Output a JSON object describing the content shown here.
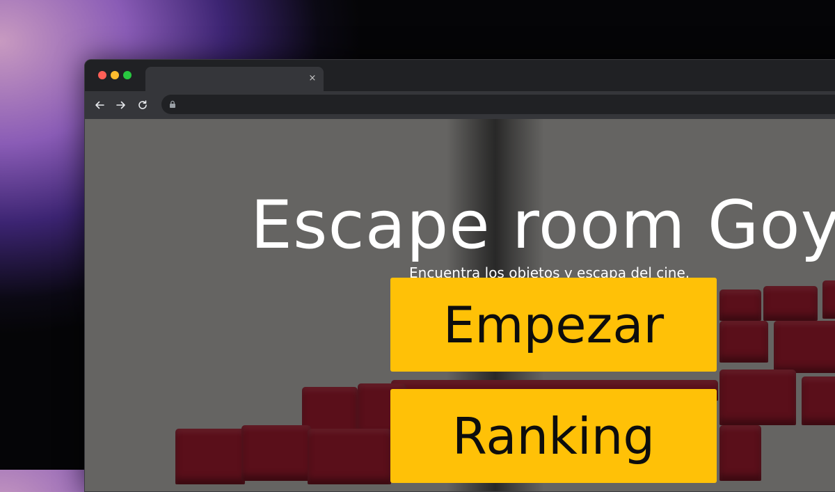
{
  "browser": {
    "tab": {
      "title": "",
      "close_glyph": "×"
    },
    "toolbar": {
      "back_icon": "arrow-left-icon",
      "forward_icon": "arrow-right-icon",
      "reload_icon": "reload-icon",
      "lock_icon": "lock-icon",
      "address": ""
    }
  },
  "page": {
    "title": "Escape room Goya",
    "subtitle": "Encuentra los objetos y escapa del cine.",
    "buttons": {
      "start_label": "Empezar",
      "ranking_label": "Ranking"
    }
  },
  "colors": {
    "button_background": "#ffc107",
    "button_text": "#0d0d0d",
    "title_text": "#ffffff",
    "seat_red": "#5a0f1a"
  }
}
